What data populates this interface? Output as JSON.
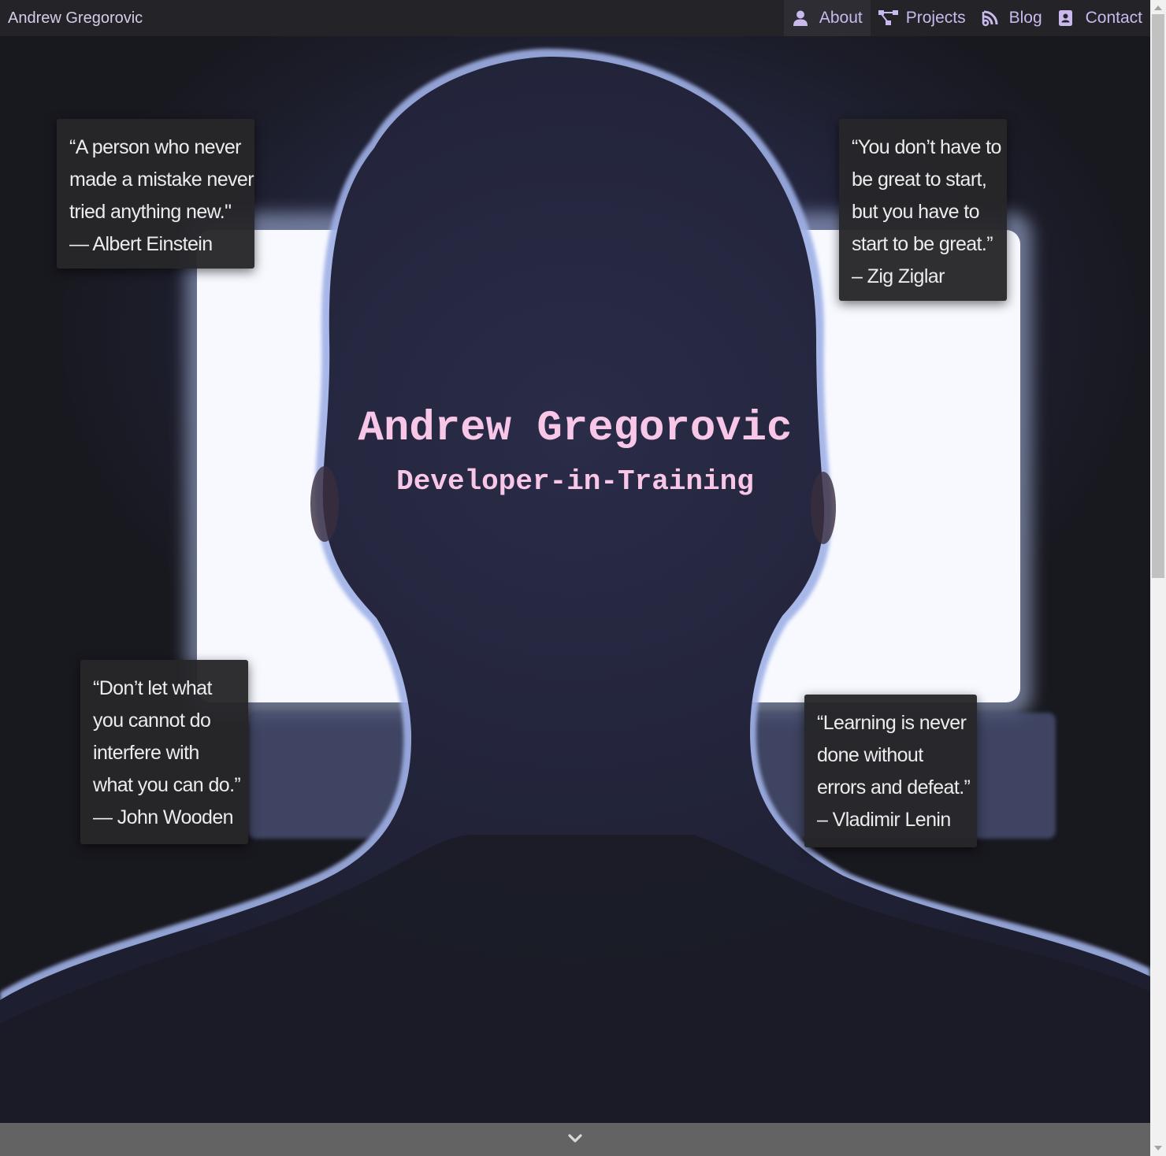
{
  "nav": {
    "brand": "Andrew Gregorovic",
    "links": [
      {
        "label": "About",
        "icon": "user-icon",
        "active": true
      },
      {
        "label": "Projects",
        "icon": "project-diagram-icon",
        "active": false
      },
      {
        "label": "Blog",
        "icon": "blog-icon",
        "active": false
      },
      {
        "label": "Contact",
        "icon": "address-book-icon",
        "active": false
      }
    ]
  },
  "hero": {
    "title": "Andrew Gregorovic",
    "subtitle": "Developer-in-Training"
  },
  "quotes": [
    {
      "lines": [
        "“A person who never",
        "made a mistake never",
        "tried anything new.\"",
        "— Albert Einstein"
      ]
    },
    {
      "lines": [
        "“You don’t have to",
        "be great to start,",
        "but you have to",
        "start to be great.”",
        "– Zig Ziglar"
      ]
    },
    {
      "lines": [
        "“Don’t let what",
        "you cannot do",
        "interfere with",
        "what you can do.”",
        "— John Wooden"
      ]
    },
    {
      "lines": [
        "“Learning is never",
        "done without",
        "errors and defeat.”",
        "– Vladimir Lenin"
      ]
    }
  ],
  "scroll_down_icon": "chevron-down-icon",
  "colors": {
    "accent": "#f8c6e6",
    "nav_link": "#c9b9ee",
    "nav_bg": "#242428",
    "quote_bg": "#26262a",
    "bottom_bar": "#636363"
  }
}
